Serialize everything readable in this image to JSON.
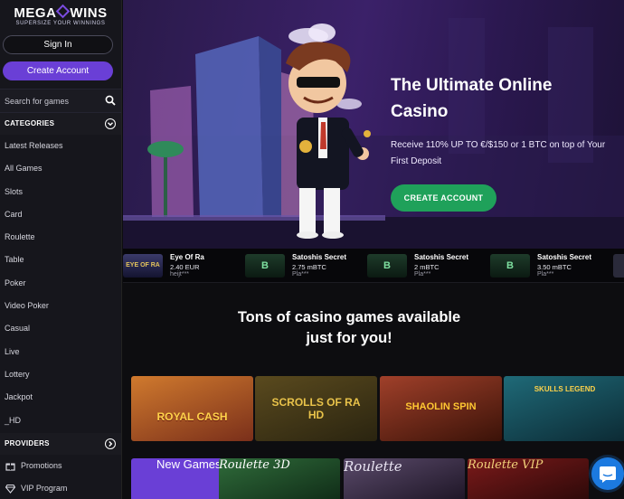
{
  "logo": {
    "brand_left": "MEGA",
    "brand_right": "WINS",
    "tagline": "SUPERSIZE YOUR WINNINGS"
  },
  "auth": {
    "signin_label": "Sign In",
    "create_label": "Create Account"
  },
  "search": {
    "placeholder": "Search for games"
  },
  "categories": {
    "heading": "CATEGORIES",
    "items": [
      {
        "label": "Latest Releases"
      },
      {
        "label": "All Games"
      },
      {
        "label": "Slots"
      },
      {
        "label": "Card"
      },
      {
        "label": "Roulette"
      },
      {
        "label": "Table"
      },
      {
        "label": "Poker"
      },
      {
        "label": "Video Poker"
      },
      {
        "label": "Casual"
      },
      {
        "label": "Live"
      },
      {
        "label": "Lottery"
      },
      {
        "label": "Jackpot"
      },
      {
        "label": "_HD"
      }
    ]
  },
  "providers": {
    "heading": "PROVIDERS"
  },
  "extra_nav": [
    {
      "label": "Promotions",
      "icon": "gift-icon"
    },
    {
      "label": "VIP Program",
      "icon": "diamond-icon"
    }
  ],
  "hero": {
    "title": "The Ultimate Online Casino",
    "subtitle": "Receive 110% UP TO €/$150 or 1 BTC on top of Your First Deposit",
    "cta_label": "CREATE ACCOUNT"
  },
  "ticker": [
    {
      "game": "Eye Of Ra",
      "amount": "2.40 EUR",
      "user": "heijt***",
      "thumb_text": "EYE OF RA"
    },
    {
      "game": "Satoshis Secret",
      "amount": "2.75 mBTC",
      "user": "Pla***",
      "thumb_text": "B"
    },
    {
      "game": "Satoshis Secret",
      "amount": "2 mBTC",
      "user": "Pla***",
      "thumb_text": "B"
    },
    {
      "game": "Satoshis Secret",
      "amount": "3.50 mBTC",
      "user": "Pla***",
      "thumb_text": "B"
    }
  ],
  "main": {
    "headline_line1": "Tons of casino games available",
    "headline_line2": "just for you!"
  },
  "games_row1": [
    {
      "name": "ROYAL CASH"
    },
    {
      "name": "SCROLLS OF RA HD"
    },
    {
      "name": "SHAOLIN SPIN"
    },
    {
      "name": "SKULLS LEGEND"
    }
  ],
  "games_row2": [
    {
      "name": "New Games"
    },
    {
      "name": "Roulette 3D"
    },
    {
      "name": "Roulette"
    },
    {
      "name": "Roulette VIP"
    }
  ],
  "colors": {
    "accent": "#6a3fd6",
    "cta": "#1fa15a",
    "chat": "#1c7ae0",
    "sidebar_bg": "#16161c"
  }
}
